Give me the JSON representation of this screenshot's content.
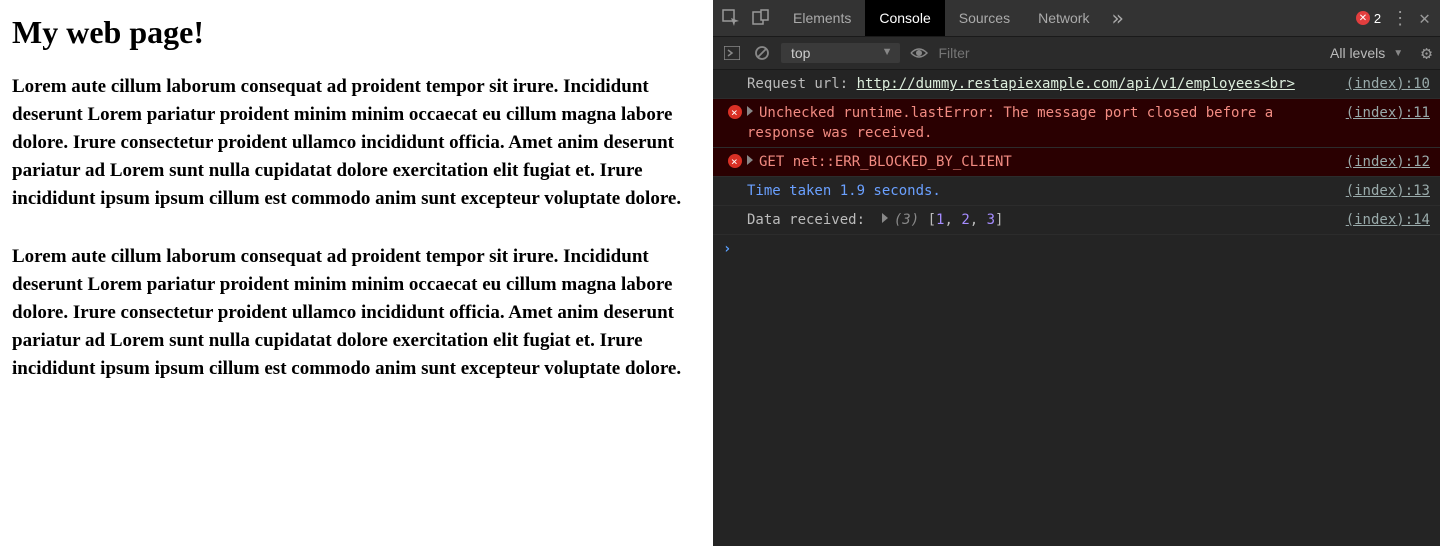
{
  "page": {
    "title": "My web page!",
    "para1": "Lorem aute cillum laborum consequat ad proident tempor sit irure. Incididunt deserunt Lorem pariatur proident minim minim occaecat eu cillum magna labore dolore. Irure consectetur proident ullamco incididunt officia. Amet anim deserunt pariatur ad Lorem sunt nulla cupidatat dolore exercitation elit fugiat et. Irure incididunt ipsum ipsum cillum est commodo anim sunt excepteur voluptate dolore.",
    "para2": "Lorem aute cillum laborum consequat ad proident tempor sit irure. Incididunt deserunt Lorem pariatur proident minim minim occaecat eu cillum magna labore dolore. Irure consectetur proident ullamco incididunt officia. Amet anim deserunt pariatur ad Lorem sunt nulla cupidatat dolore exercitation elit fugiat et. Irure incididunt ipsum ipsum cillum est commodo anim sunt excepteur voluptate dolore."
  },
  "devtools": {
    "tabs": {
      "elements": "Elements",
      "console": "Console",
      "sources": "Sources",
      "network": "Network"
    },
    "error_count": "2",
    "toolbar": {
      "top": "top",
      "filter_placeholder": "Filter",
      "levels": "All levels"
    },
    "rows": {
      "r0_label": "Request url: ",
      "r0_url": "http://dummy.restapiexample.com/api/v1/employees<br>",
      "r0_src": "(index):10",
      "r1_msg": "Unchecked runtime.lastError: The message port closed before a response was received.",
      "r1_src": "(index):11",
      "r2_msg": "GET net::ERR_BLOCKED_BY_CLIENT",
      "r2_src": "(index):12",
      "r3_msg": "Time taken 1.9 seconds.",
      "r3_src": "(index):13",
      "r4_label": "Data received:  ",
      "r4_count": "(3)",
      "r4_open": " [",
      "r4_n1": "1",
      "r4_c1": ", ",
      "r4_n2": "2",
      "r4_c2": ", ",
      "r4_n3": "3",
      "r4_close": "]",
      "r4_src": "(index):14"
    }
  }
}
